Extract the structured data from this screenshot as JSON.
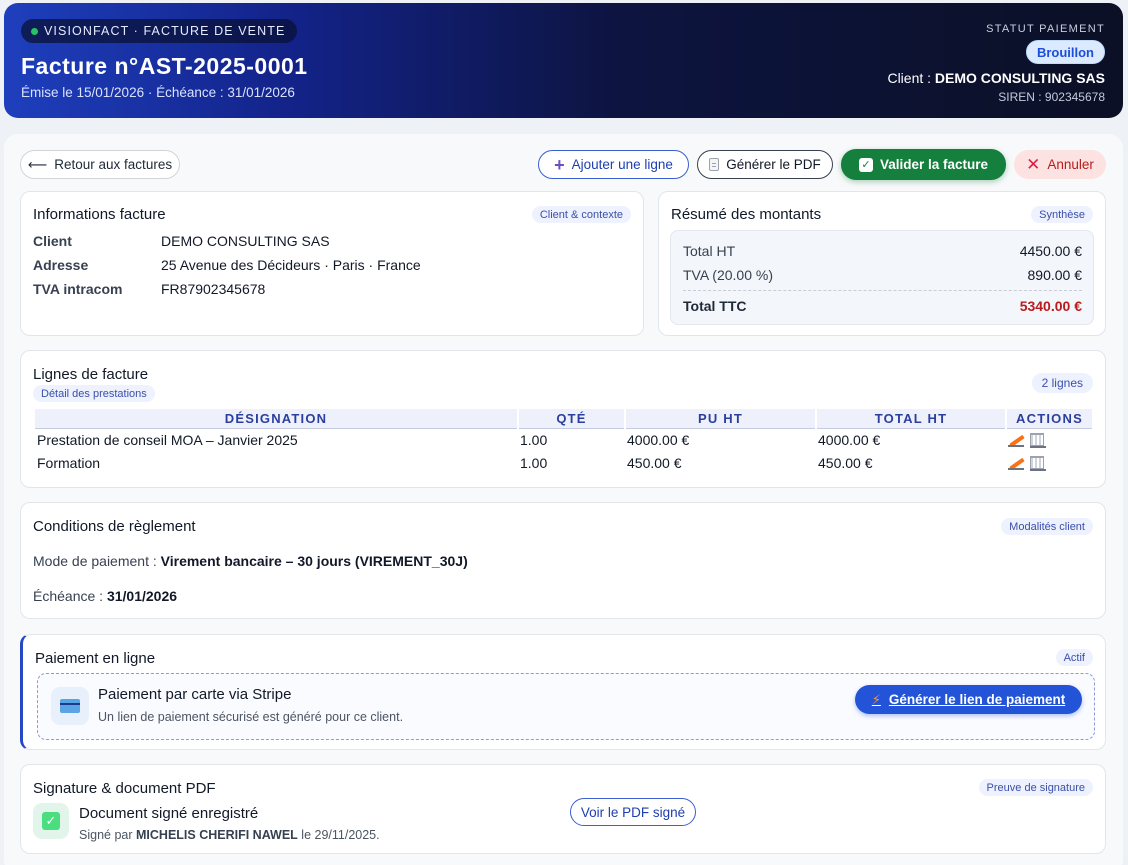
{
  "header": {
    "brand": "VISIONFACT · FACTURE DE VENTE",
    "title": "Facture n°AST-2025-0001",
    "dates": "Émise le 15/01/2026 · Échéance : 31/01/2026",
    "status_label": "STATUT PAIEMENT",
    "status_value": "Brouillon",
    "client_prefix": "Client :",
    "client_name": "DEMO CONSULTING SAS",
    "siren": "SIREN : 902345678"
  },
  "toolbar": {
    "back": "Retour aux factures",
    "add_line": "Ajouter une ligne",
    "generate_pdf": "Générer le PDF",
    "validate": "Valider la facture",
    "cancel": "Annuler"
  },
  "info": {
    "title": "Informations facture",
    "tag": "Client & contexte",
    "rows": [
      {
        "label": "Client",
        "value": "DEMO CONSULTING SAS"
      },
      {
        "label": "Adresse",
        "value": "25 Avenue des Décideurs · Paris · France"
      },
      {
        "label": "TVA intracom",
        "value": "FR87902345678"
      }
    ]
  },
  "summary": {
    "title": "Résumé des montants",
    "tag": "Synthèse",
    "total_ht_label": "Total HT",
    "total_ht": "4450.00 €",
    "tva_label": "TVA (20.00 %)",
    "tva": "890.00 €",
    "ttc_label": "Total TTC",
    "ttc": "5340.00 €",
    "accent_color": "#b91c1c"
  },
  "lines": {
    "title": "Lignes de facture",
    "subtitle": "Détail des prestations",
    "count": "2 lignes",
    "headers": [
      "DÉSIGNATION",
      "QTÉ",
      "PU HT",
      "TOTAL HT",
      "ACTIONS"
    ],
    "rows": [
      {
        "designation": "Prestation de conseil MOA – Janvier 2025",
        "qty": "1.00",
        "pu": "4000.00 €",
        "total": "4000.00 €"
      },
      {
        "designation": "Formation",
        "qty": "1.00",
        "pu": "450.00 €",
        "total": "450.00 €"
      }
    ]
  },
  "conditions": {
    "title": "Conditions de règlement",
    "tag": "Modalités client",
    "mode_label": "Mode de paiement :",
    "mode_value": "Virement bancaire – 30 jours (VIREMENT_30J)",
    "due_label": "Échéance :",
    "due_value": "31/01/2026"
  },
  "payment": {
    "title": "Paiement en ligne",
    "tag": "Actif",
    "method_title": "Paiement par carte via Stripe",
    "method_sub": "Un lien de paiement sécurisé est généré pour ce client.",
    "button": "Générer le lien de paiement"
  },
  "signature": {
    "title": "Signature & document PDF",
    "tag": "Preuve de signature",
    "doc_title": "Document signé enregistré",
    "signed_by": "Signé par",
    "signer": "MICHELIS CHERIFI NAWEL",
    "signed_on": "le 29/11/2025.",
    "view_button": "Voir le PDF signé"
  }
}
